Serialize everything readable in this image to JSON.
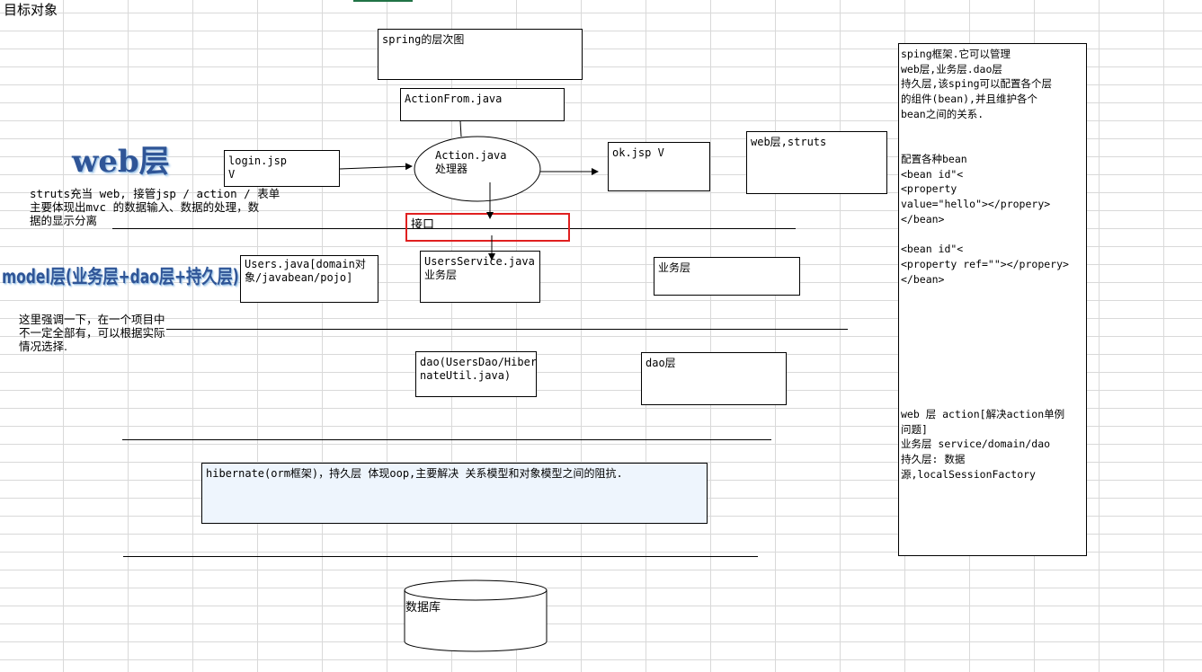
{
  "sheet": {
    "cell_label": "目标对象"
  },
  "layers": {
    "web_title": "web层",
    "model_title": "model层(业务层+dao层+持久层)"
  },
  "notes": {
    "struts_desc": "struts充当 web, 接管jsp / action / 表单\n主要体现出mvc 的数据输入、数据的处理，数\n据的显示分离",
    "emphasis": "这里强调一下，在一个项目中\n不一定全部有，可以根据实际\n情况选择."
  },
  "boxes": {
    "spring_title": "spring的层次图",
    "action_form": "ActionFrom.java",
    "login": "login.jsp\nV",
    "action": "Action.java\n处理器",
    "ok": "ok.jsp V",
    "web_struts": "web层,struts",
    "interface": "接口",
    "users_java": "Users.java[domain对\n象/javabean/pojo]",
    "users_service": "UsersService.java\n业务层",
    "business_layer": "业务层",
    "dao_files": "dao(UsersDao/Hiber\nnateUtil.java)",
    "dao_layer": "dao层",
    "hibernate": "hibernate(orm框架)，持久层 体现oop,主要解决 关系模型和对象模型之间的阻抗.",
    "database": "数据库"
  },
  "sidebar": {
    "text": "sping框架.它可以管理\nweb层,业务层.dao层\n持久层,该sping可以配置各个层\n的组件(bean),并且维护各个\nbean之间的关系.\n\n\n配置各种bean\n<bean id\"<\n<property\nvalue=\"hello\"></propery>\n</bean>\n\n<bean id\"<\n<property ref=\"\"></propery>\n</bean>\n\n\n\n\n\n\n\n\nweb 层 action[解决action单例\n问题]\n业务层 service/domain/dao\n持久层: 数据\n源,localSessionFactory"
  },
  "colors": {
    "interface_border": "#e02020",
    "hibernate_fill": "#eef5fd",
    "title_blue": "#2f5597",
    "grid": "#d9d9d9"
  }
}
